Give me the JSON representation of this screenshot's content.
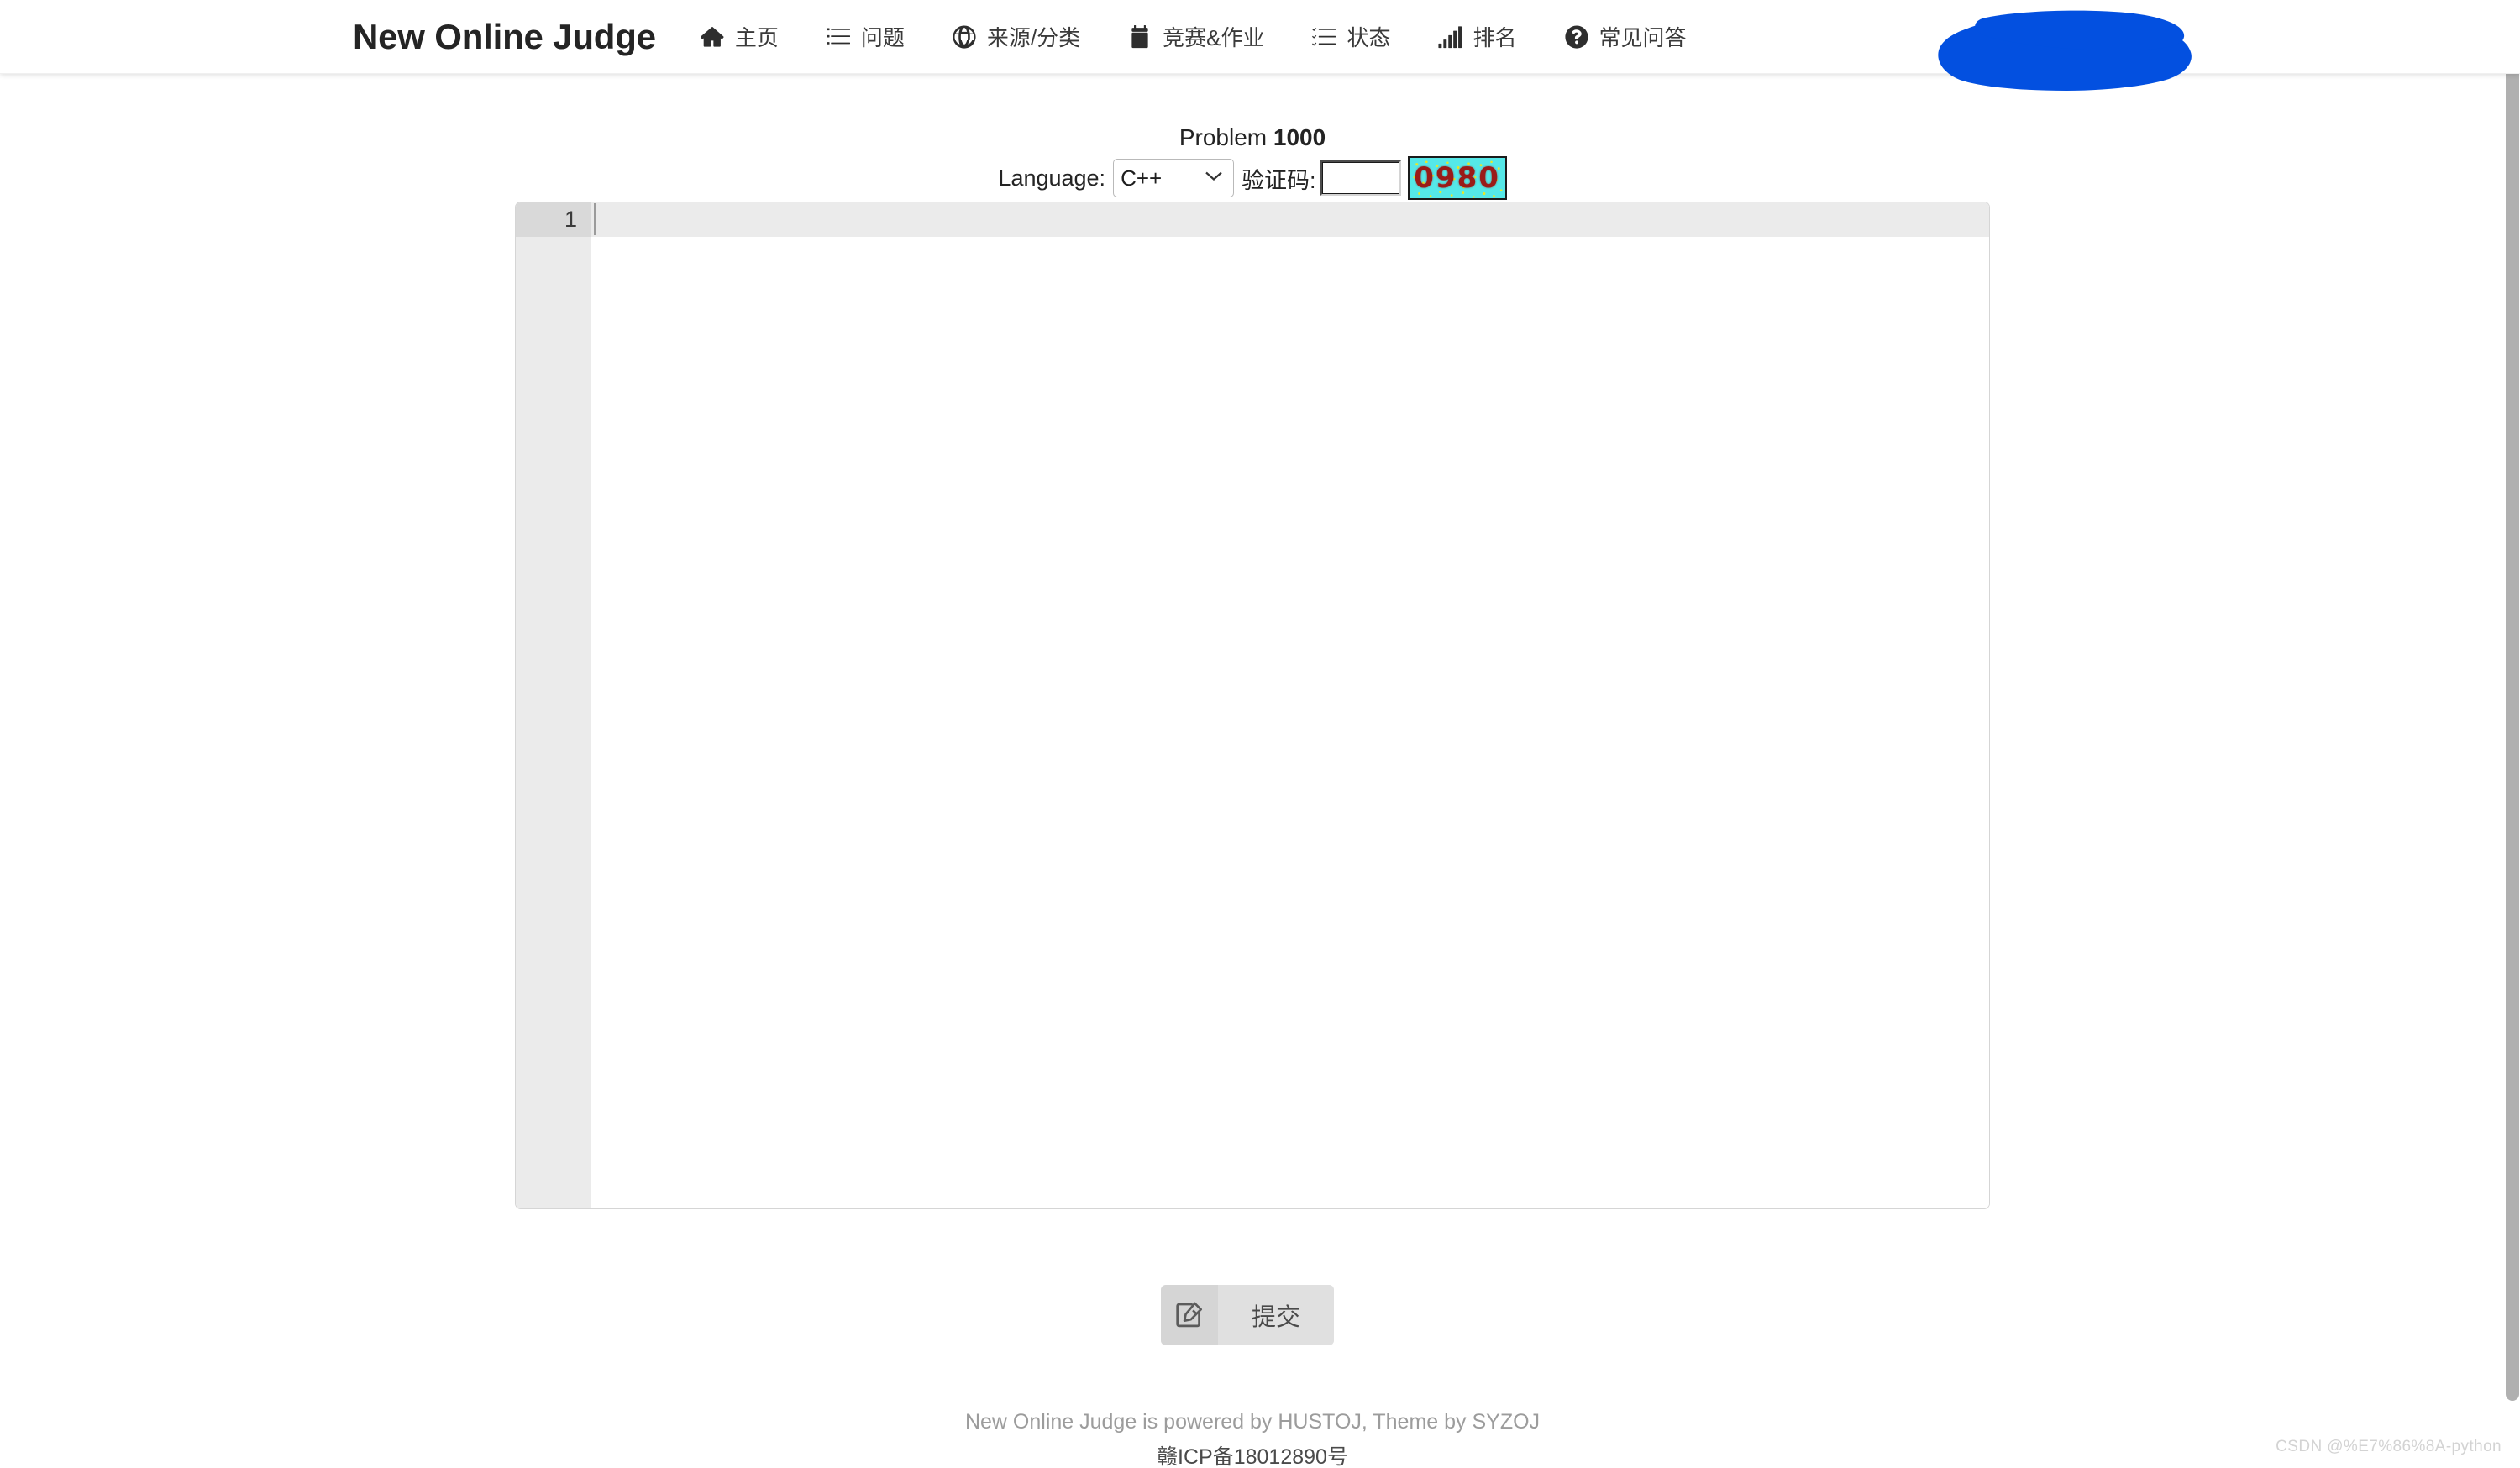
{
  "navbar": {
    "brand": "New Online Judge",
    "items": [
      {
        "label": "主页",
        "icon": "home-icon"
      },
      {
        "label": "问题",
        "icon": "list-icon"
      },
      {
        "label": "来源/分类",
        "icon": "globe-icon"
      },
      {
        "label": "竞赛&作业",
        "icon": "calendar-icon"
      },
      {
        "label": "状态",
        "icon": "tasks-icon"
      },
      {
        "label": "排名",
        "icon": "bar-chart-icon"
      },
      {
        "label": "常见问答",
        "icon": "question-circle-icon"
      }
    ],
    "redaction": {
      "name": "blue-redaction-blob",
      "color": "#0350E0"
    }
  },
  "submit_form": {
    "problem_prefix": "Problem ",
    "problem_id": "1000",
    "language_label": "Language:",
    "language_value": "C++",
    "language_options": [
      "C++"
    ],
    "captcha_label": "验证码:",
    "captcha_input_value": "",
    "captcha_input_placeholder": "",
    "captcha_image_text": "0980",
    "captcha_bg_color": "#55e8e8",
    "captcha_text_color": "#9a1b18"
  },
  "editor": {
    "line_number": "1",
    "code": "",
    "placeholder": ""
  },
  "actions": {
    "submit_label": "提交",
    "submit_icon": "edit-pencil-icon"
  },
  "footer": {
    "line1": "New Online Judge is powered by HUSTOJ, Theme by SYZOJ",
    "line2": "赣ICP备18012890号"
  },
  "watermark": {
    "text": "CSDN @%E7%86%8A-python"
  }
}
